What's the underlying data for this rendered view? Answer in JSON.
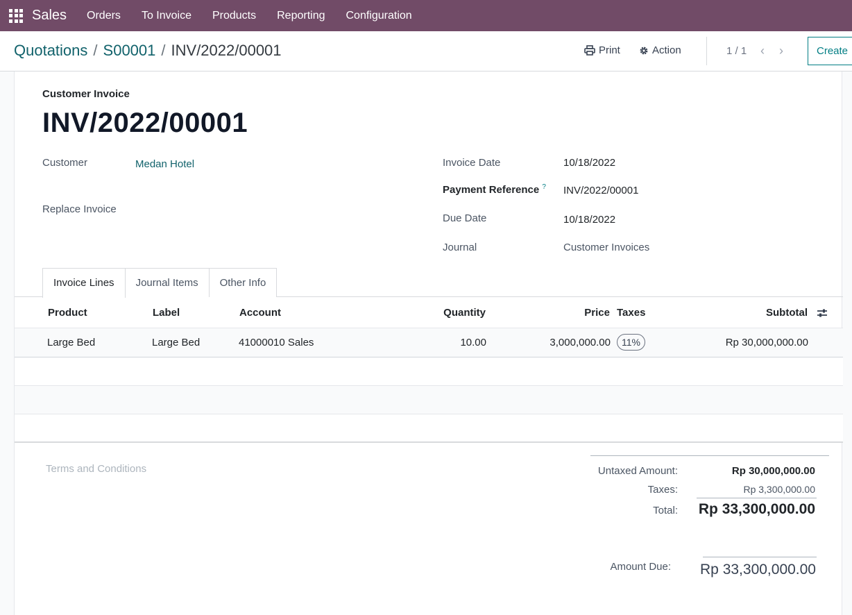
{
  "nav": {
    "app_name": "Sales",
    "items": [
      "Orders",
      "To Invoice",
      "Products",
      "Reporting",
      "Configuration"
    ]
  },
  "breadcrumb": {
    "items": [
      "Quotations",
      "S00001"
    ],
    "current": "INV/2022/00001"
  },
  "toolbar": {
    "print_label": "Print",
    "action_label": "Action",
    "pager": "1 / 1",
    "create_label": "Create"
  },
  "form": {
    "doc_type": "Customer Invoice",
    "title": "INV/2022/00001",
    "customer_label": "Customer",
    "customer_value": "Medan Hotel",
    "replace_invoice_label": "Replace Invoice",
    "invoice_date_label": "Invoice Date",
    "invoice_date_value": "10/18/2022",
    "payment_ref_label": "Payment Reference",
    "payment_ref_help": "?",
    "payment_ref_value": "INV/2022/00001",
    "due_date_label": "Due Date",
    "due_date_value": "10/18/2022",
    "journal_label": "Journal",
    "journal_value": "Customer Invoices"
  },
  "tabs": [
    "Invoice Lines",
    "Journal Items",
    "Other Info"
  ],
  "lines": {
    "headers": {
      "product": "Product",
      "label": "Label",
      "account": "Account",
      "quantity": "Quantity",
      "price": "Price",
      "taxes": "Taxes",
      "subtotal": "Subtotal"
    },
    "rows": [
      {
        "product": "Large Bed",
        "label": "Large Bed",
        "account": "41000010 Sales",
        "quantity": "10.00",
        "price": "3,000,000.00",
        "taxes": "11%",
        "subtotal": "Rp 30,000,000.00"
      }
    ]
  },
  "footer": {
    "terms_placeholder": "Terms and Conditions",
    "untaxed_label": "Untaxed Amount:",
    "untaxed_value": "Rp 30,000,000.00",
    "taxes_label": "Taxes:",
    "taxes_value": "Rp 3,300,000.00",
    "total_label": "Total:",
    "total_value": "Rp 33,300,000.00",
    "amount_due_label": "Amount Due:",
    "amount_due_value": "Rp 33,300,000.00"
  },
  "colors": {
    "nav_bg": "#714b67",
    "link": "#11626b",
    "accent": "#017e84"
  }
}
